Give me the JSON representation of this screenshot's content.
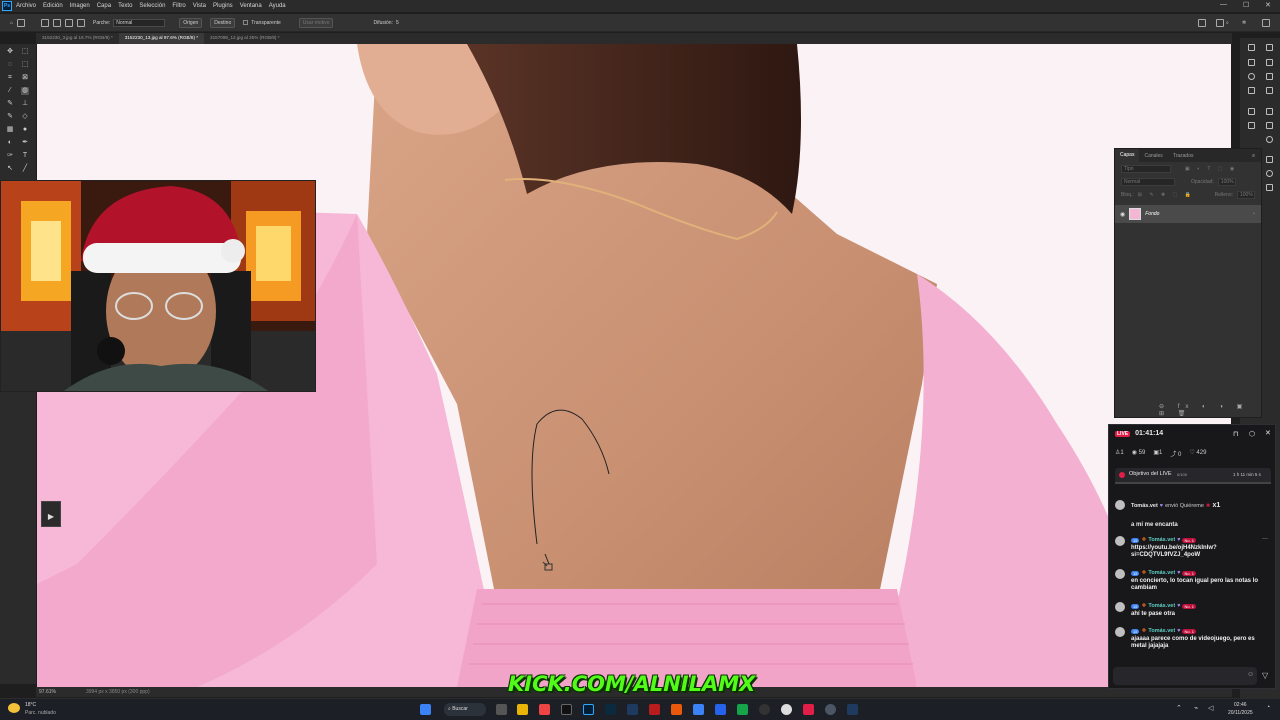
{
  "menubar": {
    "items": [
      "Archivo",
      "Edición",
      "Imagen",
      "Capa",
      "Texto",
      "Selección",
      "Filtro",
      "Vista",
      "Plugins",
      "Ventana",
      "Ayuda"
    ]
  },
  "options": {
    "parche_label": "Parche:",
    "parche_value": "Normal",
    "origen": "Origen",
    "destino": "Destino",
    "transparente": "Transparente",
    "usar_motivo": "Usar motivo",
    "difusion_label": "Difusión:",
    "difusion_value": "5"
  },
  "tabs": [
    "3152230_3.jpg al 16.7% (RGB/8) *",
    "3152230_13.jpg al 97.6% (RGB/8) *",
    "3157098_12.jpg al 25% (RGB/8) *"
  ],
  "status": {
    "zoom": "97.61%",
    "size": "3994 px x 3850 px (300 ppp)"
  },
  "layers": {
    "tabs": [
      "Capas",
      "Canales",
      "Trazados"
    ],
    "search_placeholder": "Tipo",
    "blend": "Normal",
    "opacity_label": "Opacidad:",
    "opacity_value": "100%",
    "lock_label": "Bloq.:",
    "fill_label": "Relleno:",
    "fill_value": "100%",
    "layer_name": "Fondo"
  },
  "live": {
    "badge": "LIVE",
    "timer": "01:41:14",
    "stats": {
      "viewers": "1",
      "views": "59",
      "gifts": "1",
      "shares": "0",
      "likes": "429"
    },
    "goal_label": "Objetivo del LIVE",
    "goal_count": "0/100",
    "goal_time": "1 h 11 min 5 s",
    "gift_user": "Tomás.vet",
    "gift_text": "envió Quiéreme",
    "gift_count": "x1",
    "first_line": "a mí me encanta",
    "messages": [
      {
        "level": "15",
        "user": "Tomás.vet",
        "rank": "No. 1",
        "text": "https://youtu.be/ojH4NzkInIw?si=CDQTVL9fVZJ_4poW"
      },
      {
        "level": "15",
        "user": "Tomás.vet",
        "rank": "No. 1",
        "text": "en concierto, lo tocan igual pero las notas lo cambiam"
      },
      {
        "level": "15",
        "user": "Tomás.vet",
        "rank": "No. 1",
        "text": "ahí te pase otra"
      },
      {
        "level": "15",
        "user": "Tomás.vet",
        "rank": "No. 1",
        "text": "ajaaaa parece como de videojuego, pero es metal jajajaja"
      }
    ]
  },
  "overlay": {
    "kick": "KICK.COM/ALNILAMX"
  },
  "taskbar": {
    "weather_temp": "18°C",
    "weather_desc": "Parc. nublado",
    "search": "Buscar",
    "time": "02:46",
    "date": "20/11/2025"
  },
  "colors": {
    "accent": "#31a8ff",
    "live_red": "#e11d48",
    "kick_green": "#53fc18"
  }
}
